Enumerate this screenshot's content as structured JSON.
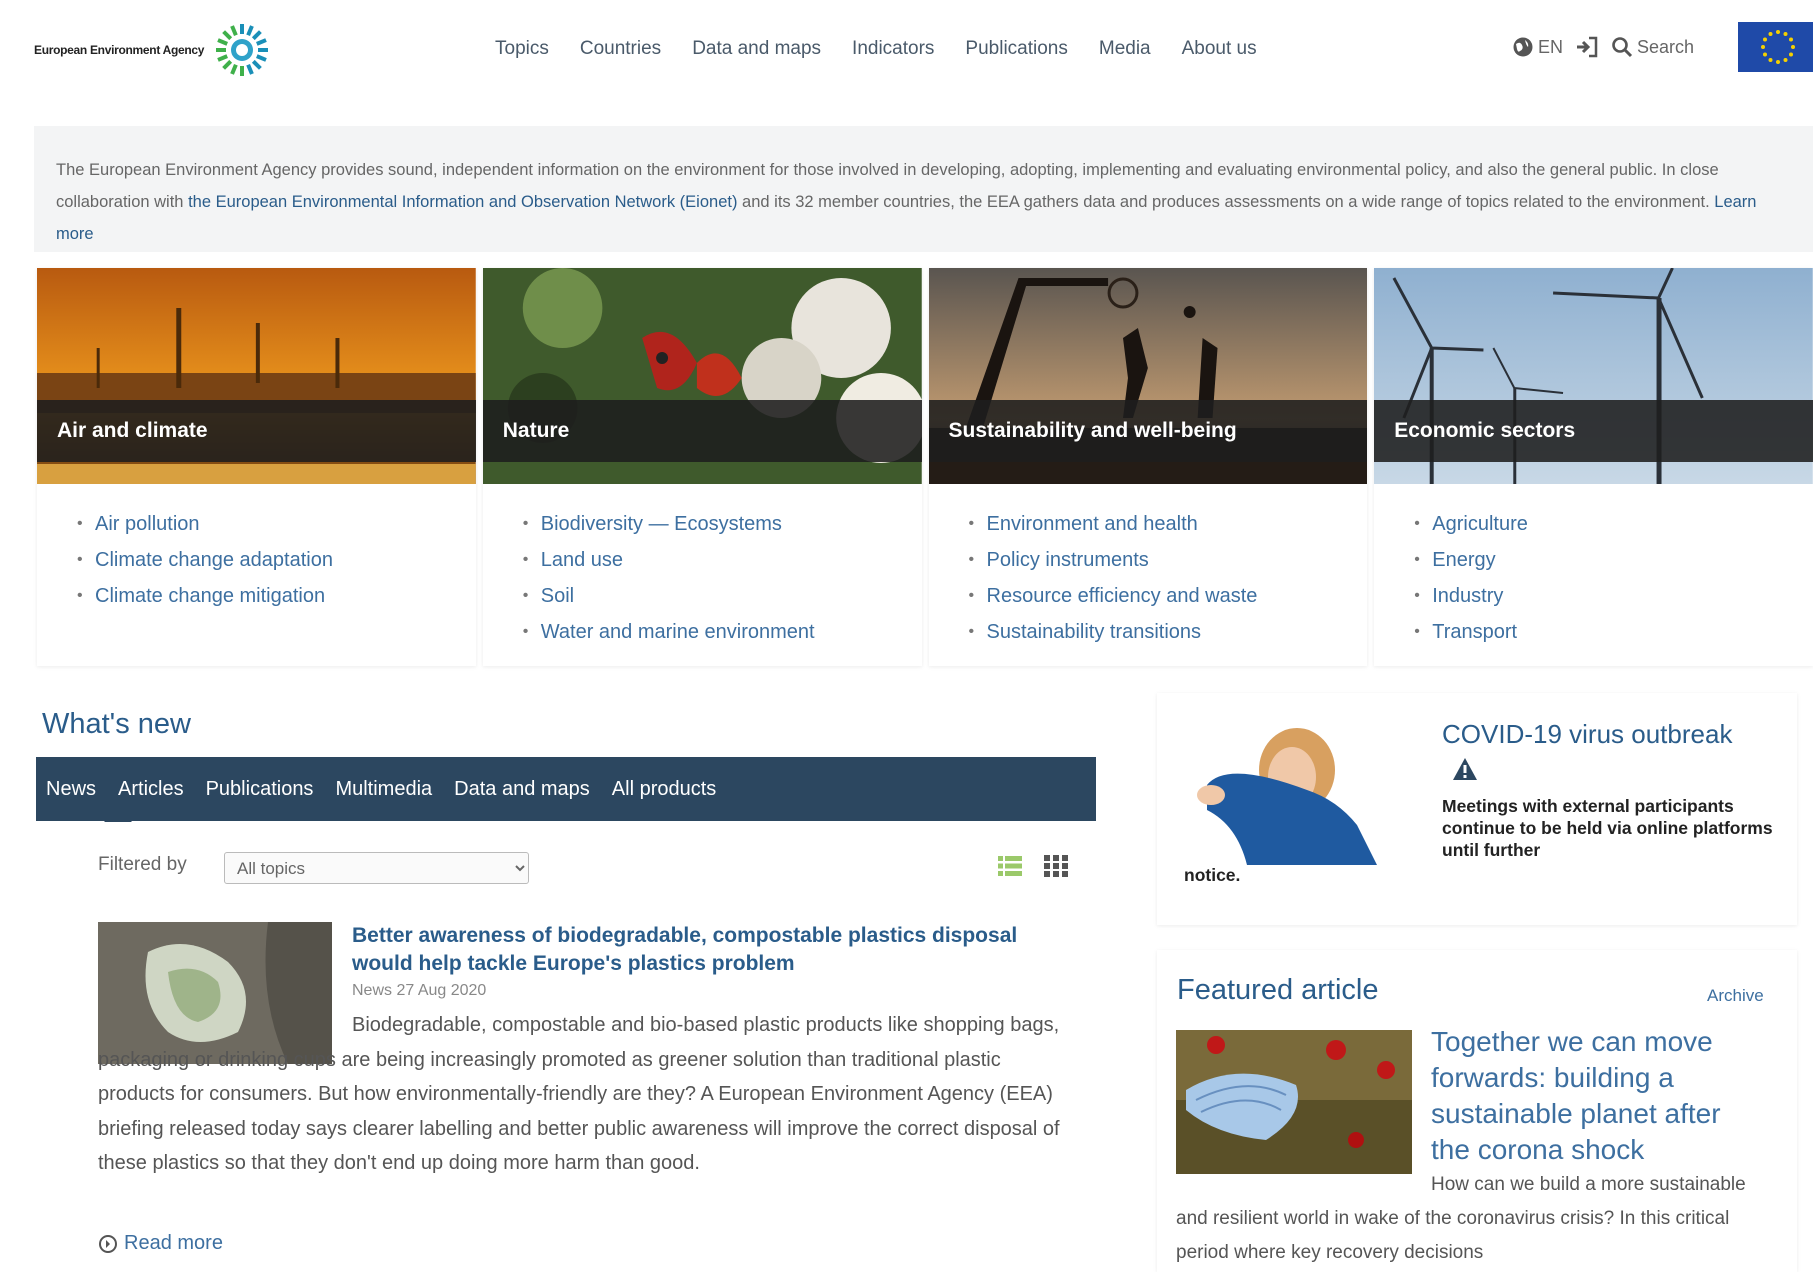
{
  "header": {
    "brand": "European Environment Agency",
    "nav": [
      "Topics",
      "Countries",
      "Data and maps",
      "Indicators",
      "Publications",
      "Media",
      "About us"
    ],
    "lang": "EN",
    "search": "Search"
  },
  "intro": {
    "text_before": "The European Environment Agency provides sound, independent information on the environment for those involved in developing, adopting, implementing and evaluating environmental policy, and also the general public. In close collaboration with ",
    "link": "the European Environmental Information and Observation Network (Eionet)",
    "text_after": " and its 32 member countries, the EEA gathers data and produces assessments on a wide range of topics related to the environment. ",
    "learn_more": "Learn more"
  },
  "topics": [
    {
      "title": "Air and climate",
      "items": [
        "Air pollution",
        "Climate change adaptation",
        "Climate change mitigation"
      ]
    },
    {
      "title": "Nature",
      "items": [
        "Biodiversity — Ecosystems",
        "Land use",
        "Soil",
        "Water and marine environment"
      ]
    },
    {
      "title": "Sustainability and well-being",
      "items": [
        "Environment and health",
        "Policy instruments",
        "Resource efficiency and waste",
        "Sustainability transitions"
      ]
    },
    {
      "title": "Economic sectors",
      "items": [
        "Agriculture",
        "Energy",
        "Industry",
        "Transport"
      ]
    }
  ],
  "whats_new": {
    "title": "What's new",
    "tabs": [
      "News",
      "Articles",
      "Publications",
      "Multimedia",
      "Data and maps",
      "All products"
    ],
    "filter_label": "Filtered by",
    "filter_value": "All topics",
    "article": {
      "title": "Better awareness of biodegradable, compostable plastics disposal would help tackle Europe's plastics problem",
      "meta": "News 27 Aug 2020",
      "text": "Biodegradable, compostable and bio-based plastic products like shopping bags, packaging or drinking cups are being increasingly promoted as greener solution than traditional plastic products for consumers. But how environmentally-friendly are they? A European Environment Agency (EEA) briefing released today says clearer labelling and better public awareness will improve the correct disposal of these plastics so that they don't end up doing more harm than good."
    },
    "read_more": "Read more"
  },
  "covid": {
    "title": "COVID-19 virus outbreak",
    "text": "Meetings with external participants continue to be held via online platforms until further",
    "notice": "notice."
  },
  "featured": {
    "title": "Featured article",
    "archive": "Archive",
    "headline": "Together we can move forwards: building a sustainable planet after the corona shock",
    "text": "How can we build a more sustainable and resilient world in wake of the coronavirus crisis? In this critical period where key recovery decisions"
  },
  "colors": {
    "link_blue": "#2a5c8a",
    "tab_bar": "#2c4760",
    "banner": "#1e1e1e",
    "eu_blue": "#1f4aa8"
  }
}
